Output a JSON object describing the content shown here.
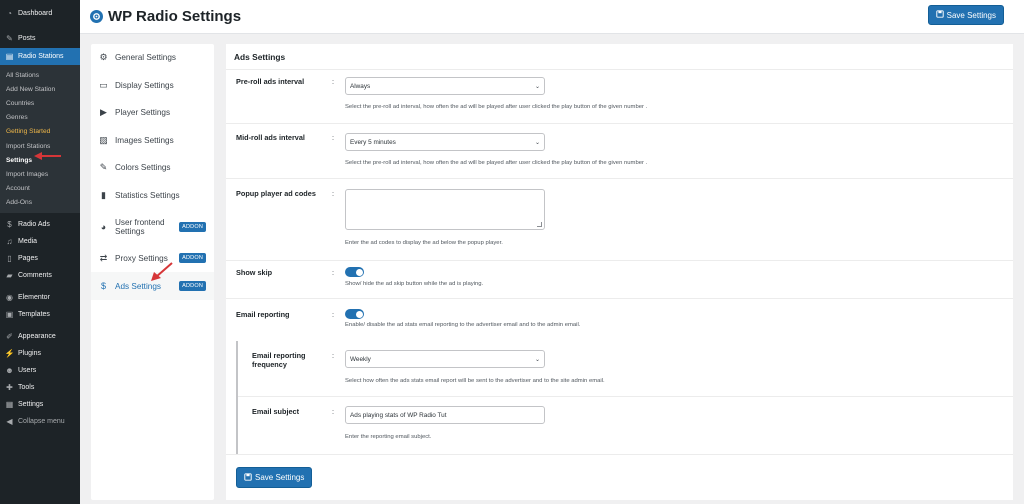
{
  "sidebar": {
    "top_items": [
      {
        "label": "Dashboard",
        "icon": "dashboard-icon"
      },
      {
        "label": "Posts",
        "icon": "pin-icon"
      },
      {
        "label": "Radio Stations",
        "icon": "radio-icon"
      }
    ],
    "submenu": [
      {
        "label": "All Stations"
      },
      {
        "label": "Add New Station"
      },
      {
        "label": "Countries"
      },
      {
        "label": "Genres"
      },
      {
        "label": "Getting Started"
      },
      {
        "label": "Import Stations"
      },
      {
        "label": "Settings"
      },
      {
        "label": "Import Images"
      },
      {
        "label": "Account"
      },
      {
        "label": "Add-Ons"
      }
    ],
    "bottom_items": [
      {
        "label": "Radio Ads",
        "icon": "dollar-icon"
      },
      {
        "label": "Media",
        "icon": "media-icon"
      },
      {
        "label": "Pages",
        "icon": "pages-icon"
      },
      {
        "label": "Comments",
        "icon": "comments-icon"
      },
      {
        "label": "Elementor",
        "icon": "elementor-icon"
      },
      {
        "label": "Templates",
        "icon": "templates-icon"
      },
      {
        "label": "Appearance",
        "icon": "brush-icon"
      },
      {
        "label": "Plugins",
        "icon": "plugin-icon"
      },
      {
        "label": "Users",
        "icon": "users-icon"
      },
      {
        "label": "Tools",
        "icon": "wrench-icon"
      },
      {
        "label": "Settings",
        "icon": "settings-icon"
      },
      {
        "label": "Collapse menu",
        "icon": "collapse-icon"
      }
    ]
  },
  "header": {
    "title": "WP Radio Settings",
    "save_label": "Save Settings"
  },
  "settings_nav": {
    "items": [
      {
        "label": "General Settings",
        "icon": "gear-icon"
      },
      {
        "label": "Display Settings",
        "icon": "display-icon"
      },
      {
        "label": "Player Settings",
        "icon": "play-icon"
      },
      {
        "label": "Images Settings",
        "icon": "image-icon"
      },
      {
        "label": "Colors Settings",
        "icon": "brush-icon"
      },
      {
        "label": "Statistics Settings",
        "icon": "bar-chart-icon"
      },
      {
        "label": "User frontend Settings",
        "icon": "user-circle-icon",
        "badge": "ADDON"
      },
      {
        "label": "Proxy Settings",
        "icon": "repeat-icon",
        "badge": "ADDON"
      },
      {
        "label": "Ads Settings",
        "icon": "dollar-icon",
        "badge": "ADDON"
      }
    ]
  },
  "ads": {
    "section_title": "Ads Settings",
    "preroll": {
      "label": "Pre-roll ads interval",
      "value": "Always",
      "desc": "Select the pre-roll ad interval, how often the ad will be played after user clicked the play button of the given number ."
    },
    "midroll": {
      "label": "Mid-roll ads interval",
      "value": "Every 5 minutes",
      "desc": "Select the pre-roll ad interval, how often the ad will be played after user clicked the play button of the given number ."
    },
    "popup": {
      "label": "Popup player ad codes",
      "value": "",
      "desc": "Enter the ad codes to display the ad below the popup player."
    },
    "show_skip": {
      "label": "Show skip",
      "enabled": true,
      "desc": "Show/ hide the ad skip button while the ad is playing."
    },
    "email_reporting": {
      "label": "Email reporting",
      "enabled": true,
      "desc": "Enable/ disable the ad stats email reporting to the advertiser email and to the admin email."
    },
    "frequency": {
      "label_line1": "Email reporting",
      "label_line2": "frequency",
      "value": "Weekly",
      "desc": "Select how often the ads stats email report will be sent to the advertiser and to the site admin email."
    },
    "subject": {
      "label": "Email subject",
      "value": "Ads playing stats of WP Radio Tut",
      "desc": "Enter the reporting email subject."
    },
    "colon": ":",
    "save_label": "Save Settings"
  },
  "colors": {
    "accent": "#2271b1",
    "sidebar_bg": "#1d2327",
    "arrow": "#d63638"
  }
}
